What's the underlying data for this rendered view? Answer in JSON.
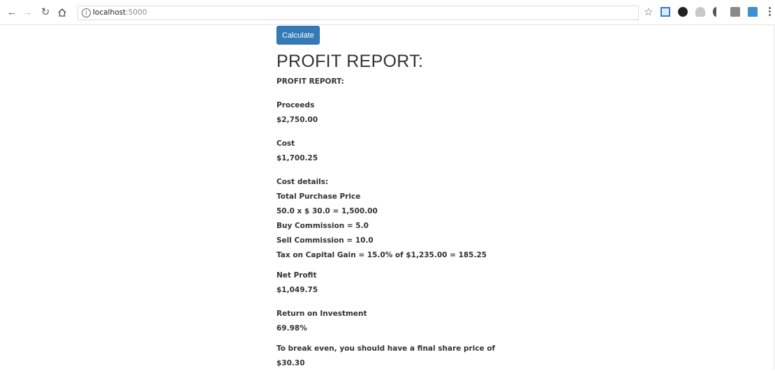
{
  "browser": {
    "back_icon": "arrow-left-icon",
    "forward_icon": "arrow-right-icon",
    "reload_icon": "reload-icon",
    "home_icon": "home-icon",
    "url_host": "localhost",
    "url_port": ":5000",
    "bookmark_icon": "star-icon",
    "extensions": [
      "extension-blue-icon",
      "extension-dark-icon",
      "extension-gray-icon",
      "extension-moon-icon",
      "extension-square-icon",
      "extension-lock-icon"
    ]
  },
  "page": {
    "calculate_label": "Calculate",
    "title": "PROFIT REPORT:",
    "subtitle": "PROFIT REPORT:",
    "proceeds_label": "Proceeds",
    "proceeds_value": "$2,750.00",
    "cost_label": "Cost",
    "cost_value": "$1,700.25",
    "cost_details_label": "Cost details:",
    "total_purchase_label": "Total Purchase Price",
    "total_purchase_value": "50.0 x $ 30.0 = 1,500.00",
    "buy_commission": "Buy Commission = 5.0",
    "sell_commission": "Sell Commission = 10.0",
    "tax": "Tax on Capital Gain = 15.0% of $1,235.00 = 185.25",
    "net_profit_label": "Net Profit",
    "net_profit_value": "$1,049.75",
    "roi_label": "Return on Investment",
    "roi_value": "69.98%",
    "break_even_label": "To break even, you should have a final share price of",
    "break_even_value": "$30.30"
  }
}
